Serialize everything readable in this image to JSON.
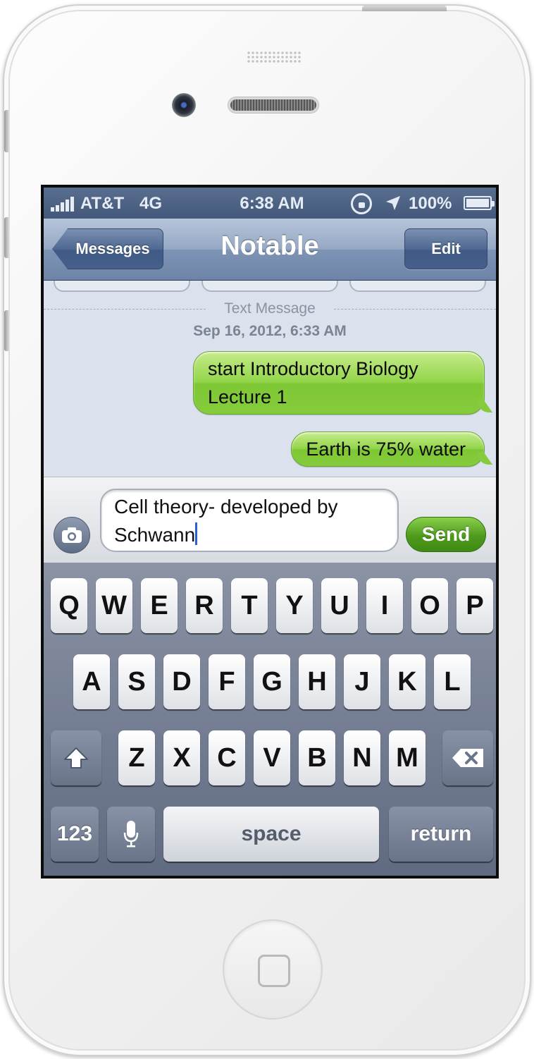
{
  "status_bar": {
    "carrier": "AT&T",
    "network": "4G",
    "time": "6:38 AM",
    "battery": "100%",
    "icons": [
      "signal-bars-icon",
      "rotation-lock-icon",
      "location-arrow-icon",
      "battery-icon"
    ]
  },
  "nav": {
    "back_label": "Messages",
    "title": "Notable",
    "edit_label": "Edit"
  },
  "thread": {
    "header": "Text Message",
    "timestamp": "Sep 16, 2012, 6:33 AM",
    "messages": [
      {
        "text": "start Introductory Biology Lecture 1",
        "direction": "sent"
      },
      {
        "text": "Earth is 75% water",
        "direction": "sent"
      }
    ]
  },
  "compose": {
    "text": "Cell theory- developed by Schwann",
    "send_label": "Send"
  },
  "keyboard": {
    "row1": [
      "Q",
      "W",
      "E",
      "R",
      "T",
      "Y",
      "U",
      "I",
      "O",
      "P"
    ],
    "row2": [
      "A",
      "S",
      "D",
      "F",
      "G",
      "H",
      "J",
      "K",
      "L"
    ],
    "row3": [
      "Z",
      "X",
      "C",
      "V",
      "B",
      "N",
      "M"
    ],
    "numbers_label": "123",
    "space_label": "space",
    "return_label": "return"
  },
  "colors": {
    "sent_bubble": "#85cc3c",
    "send_button": "#4f9a1d",
    "nav_bar": "#7e94b5",
    "thread_background": "#dbe2ed"
  }
}
